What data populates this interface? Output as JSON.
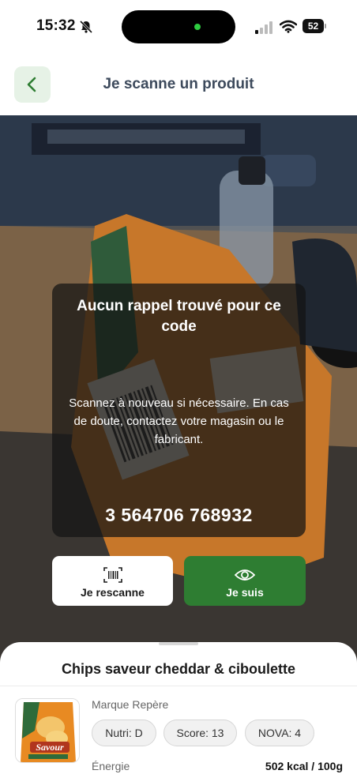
{
  "status": {
    "time": "15:32",
    "battery": "52"
  },
  "header": {
    "title": "Je scanne un produit"
  },
  "result": {
    "title": "Aucun rappel trouvé pour ce code",
    "message": "Scannez à nouveau si nécessaire. En cas de doute, contactez votre magasin ou le fabricant.",
    "barcode": "3 564706 768932"
  },
  "actions": {
    "rescan_label": "Je rescanne",
    "follow_label": "Je suis"
  },
  "product": {
    "name": "Chips saveur cheddar & ciboulette",
    "brand": "Marque Repère",
    "chips": {
      "nutri": "Nutri: D",
      "score": "Score: 13",
      "nova": "NOVA: 4"
    },
    "energy_label": "Énergie",
    "energy_value": "502 kcal / 100g",
    "thumb_brand": "Savour"
  },
  "colors": {
    "accent_green": "#2e7d32",
    "back_bg": "#e6f2e6",
    "overlay": "rgba(20,20,20,0.72)"
  },
  "icons": {
    "back": "chevron-left-icon",
    "bell": "bell-slash-icon",
    "rescan": "barcode-scan-icon",
    "follow": "eye-icon"
  }
}
